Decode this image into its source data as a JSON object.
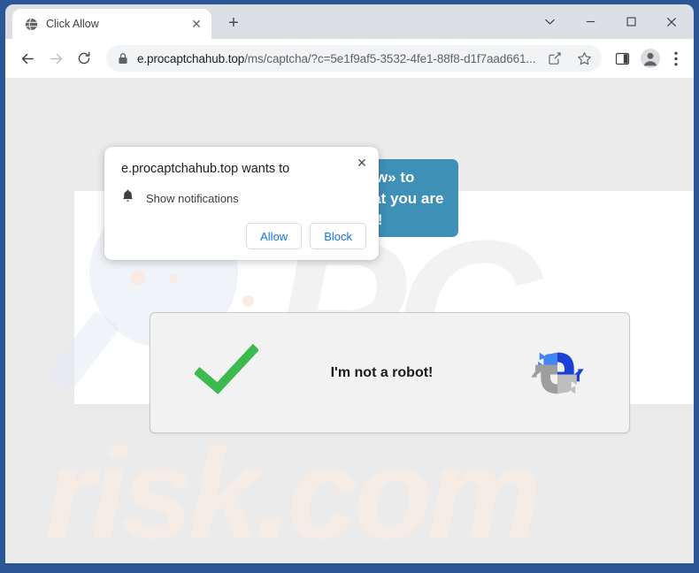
{
  "window": {
    "frame_color": "#2b5797",
    "controls": [
      {
        "name": "tab-search-button",
        "glyph": "chevron-down"
      },
      {
        "name": "minimize-button",
        "glyph": "minimize"
      },
      {
        "name": "maximize-button",
        "glyph": "maximize"
      },
      {
        "name": "close-button",
        "glyph": "close"
      }
    ]
  },
  "tabstrip": {
    "tab": {
      "title": "Click Allow",
      "favicon": "globe-icon",
      "close_label": "✕"
    },
    "new_tab_label": "+"
  },
  "toolbar": {
    "back_icon": "back-arrow-icon",
    "forward_icon": "forward-arrow-icon",
    "reload_icon": "reload-icon",
    "omnibox": {
      "lock_icon": "lock-icon",
      "host": "e.procaptchahub.top",
      "path": "/ms/captcha/?c=5e1f9af5-3532-4fe1-88f8-d1f7aad661...",
      "full_url": "e.procaptchahub.top/ms/captcha/?c=5e1f9af5-3532-4fe1-88f8-d1f7aad661...",
      "share_icon": "share-icon",
      "bookmark_icon": "star-icon"
    },
    "side_panel_icon": "side-panel-icon",
    "profile_icon": "profile-avatar-icon",
    "menu_icon": "three-dot-menu-icon"
  },
  "permission_dialog": {
    "title": "e.procaptchahub.top wants to",
    "request_icon": "bell-icon",
    "request_label": "Show notifications",
    "allow_label": "Allow",
    "block_label": "Block",
    "close_label": "✕",
    "accent_color": "#1a73e8"
  },
  "page": {
    "banner": {
      "text": "Click «Allow» to confirm that you are not a robot!",
      "background_color": "#3e90b6",
      "text_color": "#ffffff"
    },
    "captcha": {
      "check_icon": "green-checkmark-icon",
      "label": "I'm not a robot!",
      "logo_icon": "recaptcha-logo-icon",
      "check_color": "#3dba4e",
      "background_color": "#f2f2f2"
    },
    "watermark": {
      "top_text": "PC",
      "bottom_text": "risk.com",
      "magnifier_icon": "magnifier-watermark-icon"
    }
  }
}
